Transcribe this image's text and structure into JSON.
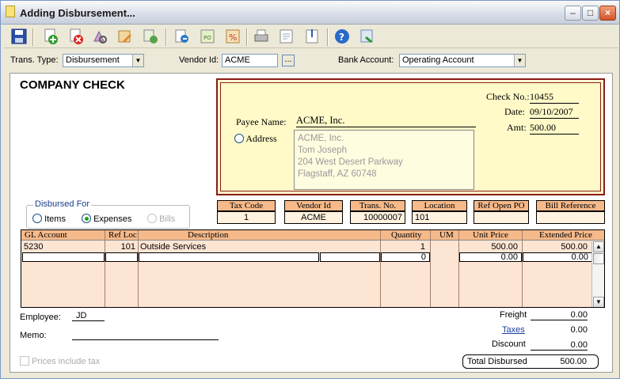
{
  "window": {
    "title": "Adding Disbursement..."
  },
  "header": {
    "trans_type_label": "Trans. Type:",
    "trans_type_value": "Disbursement",
    "vendor_id_label": "Vendor Id:",
    "vendor_id_value": "ACME",
    "vendor_lookup": "...",
    "bank_account_label": "Bank Account:",
    "bank_account_value": "Operating Account"
  },
  "check": {
    "title": "COMPANY CHECK",
    "check_no_label": "Check No.:",
    "check_no": "10455",
    "date_label": "Date:",
    "date": "09/10/2007",
    "amt_label": "Amt:",
    "amt": "500.00",
    "payee_label": "Payee Name:",
    "payee": "ACME, Inc.",
    "address_label": "Address",
    "address_lines": [
      "ACME, Inc.",
      "Tom Joseph",
      "204 West Desert Parkway",
      "Flagstaff, AZ 60748"
    ]
  },
  "disbursed_for": {
    "legend": "Disbursed For",
    "items": "Items",
    "expenses": "Expenses",
    "bills": "Bills",
    "selected": "expenses"
  },
  "info": {
    "headers": [
      "Tax Code",
      "Vendor Id",
      "Trans. No.",
      "Location",
      "Ref Open PO",
      "Bill Reference"
    ],
    "values": [
      "1",
      "ACME",
      "10000007",
      "101",
      "",
      ""
    ]
  },
  "grid": {
    "columns": [
      "GL Account",
      "Ref Loc",
      "Description",
      "Quantity",
      "UM",
      "Unit Price",
      "Extended Price"
    ],
    "rows": [
      {
        "gl": "5230",
        "loc": "101",
        "desc": "Outside Services",
        "qty": "1",
        "um": "",
        "unit": "500.00",
        "ext": "500.00"
      },
      {
        "gl": "",
        "loc": "",
        "desc": "",
        "qty": "0",
        "um": "",
        "unit": "0.00",
        "ext": "0.00"
      }
    ]
  },
  "footer": {
    "employee_label": "Employee:",
    "employee": "JD",
    "memo_label": "Memo:",
    "memo": "",
    "prices_tax": "Prices include tax",
    "freight_label": "Freight",
    "freight": "0.00",
    "taxes_label": "Taxes",
    "taxes": "0.00",
    "discount_label": "Discount",
    "discount": "0.00",
    "total_label": "Total Disbursed",
    "total": "500.00"
  },
  "colors": {
    "check_border": "#8a1c14",
    "check_bg": "#fffac8",
    "header_cell": "#f5b98a",
    "grid_bg": "#fde5d4"
  }
}
